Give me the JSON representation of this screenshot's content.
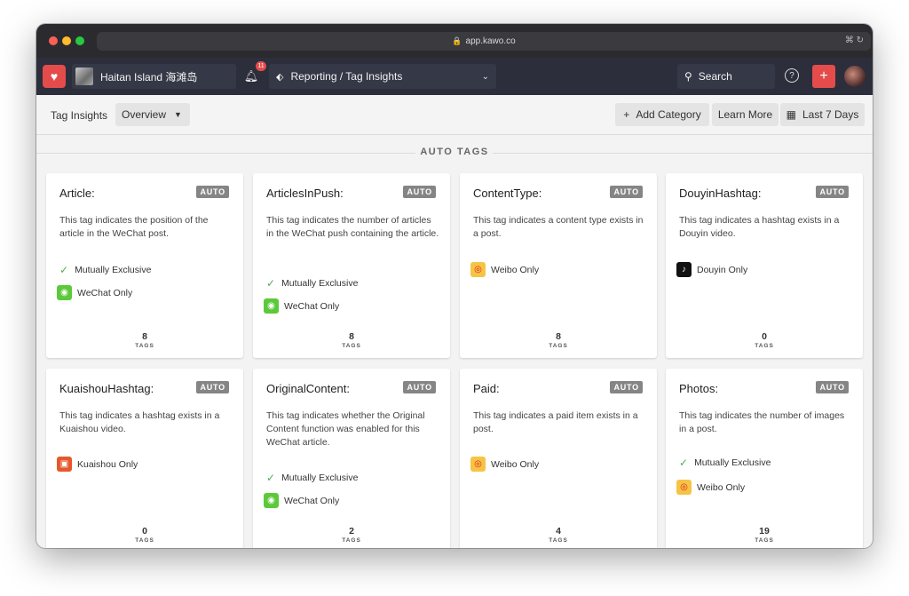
{
  "browser": {
    "url": "app.kawo.co"
  },
  "app": {
    "brand_name": "Haitan Island 海滩岛",
    "notifications_count": "11",
    "section": "Reporting / Tag Insights",
    "search_label": "Search"
  },
  "subbar": {
    "crumb": "Tag Insights",
    "view_select": "Overview",
    "add_category": "Add Category",
    "learn_more": "Learn More",
    "date_range": "Last 7 Days"
  },
  "section_title": "AUTO TAGS",
  "auto_badge": "AUTO",
  "tags_label": "TAGS",
  "mutually_exclusive": "Mutually Exclusive",
  "cards": [
    {
      "title": "Article:",
      "desc": "This tag indicates the position of the article in the WeChat post.",
      "platform": "WeChat Only",
      "count": "8"
    },
    {
      "title": "ArticlesInPush:",
      "desc": "This tag indicates the number of articles in the WeChat push containing the article.",
      "platform": "WeChat Only",
      "count": "8"
    },
    {
      "title": "ContentType:",
      "desc": "This tag indicates a content type exists in a post.",
      "platform": "Weibo Only",
      "count": "8"
    },
    {
      "title": "DouyinHashtag:",
      "desc": "This tag indicates a hashtag exists in a Douyin video.",
      "platform": "Douyin Only",
      "count": "0"
    },
    {
      "title": "KuaishouHashtag:",
      "desc": "This tag indicates a hashtag exists in a Kuaishou video.",
      "platform": "Kuaishou Only",
      "count": "0"
    },
    {
      "title": "OriginalContent:",
      "desc": "This tag indicates whether the Original Content function was enabled for this WeChat article.",
      "platform": "WeChat Only",
      "count": "2"
    },
    {
      "title": "Paid:",
      "desc": "This tag indicates a paid item exists in a post.",
      "platform": "Weibo Only",
      "count": "4"
    },
    {
      "title": "Photos:",
      "desc": "This tag indicates the number of images in a post.",
      "platform": "Weibo Only",
      "count": "19"
    }
  ],
  "icons": {
    "lock": "lock-icon",
    "translate": "translate-icon",
    "reload": "reload-icon",
    "bell": "bell-icon",
    "tag": "tag-icon",
    "search": "search-icon",
    "help": "help-icon",
    "plus": "plus-icon",
    "calendar": "calendar-icon",
    "check": "check-icon",
    "wechat": "wechat-icon",
    "weibo": "weibo-icon",
    "douyin": "douyin-icon",
    "kuaishou": "kuaishou-icon"
  },
  "colors": {
    "accent": "#e44c4c",
    "appbar": "#2c2e3b",
    "wechat": "#5cc93b",
    "weibo": "#f6c445",
    "check": "#4caf50"
  }
}
